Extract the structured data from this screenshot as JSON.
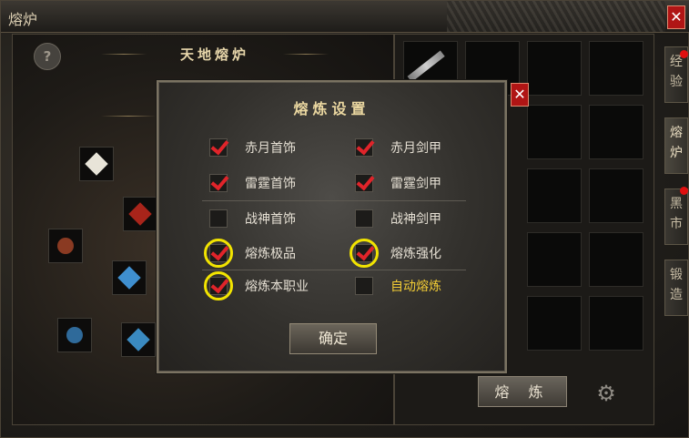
{
  "window": {
    "title": "熔炉",
    "close_label": "✕"
  },
  "furnace": {
    "title": "天地熔炉",
    "help_label": "?"
  },
  "side_tabs": [
    {
      "label": "经验"
    },
    {
      "label": "熔炉"
    },
    {
      "label": "黑市"
    },
    {
      "label": "锻造"
    }
  ],
  "smelt_button": "熔 炼",
  "dialog": {
    "title": "熔炼设置",
    "close_label": "✕",
    "ok_label": "确定",
    "options": [
      {
        "label": "赤月首饰",
        "checked": true,
        "color": "normal"
      },
      {
        "label": "赤月剑甲",
        "checked": true,
        "color": "normal"
      },
      {
        "label": "雷霆首饰",
        "checked": true,
        "color": "normal"
      },
      {
        "label": "雷霆剑甲",
        "checked": true,
        "color": "normal"
      },
      {
        "label": "战神首饰",
        "checked": false,
        "color": "normal"
      },
      {
        "label": "战神剑甲",
        "checked": false,
        "color": "normal"
      },
      {
        "label": "熔炼极品",
        "checked": true,
        "color": "normal"
      },
      {
        "label": "熔炼强化",
        "checked": true,
        "color": "normal"
      },
      {
        "label": "熔炼本职业",
        "checked": true,
        "color": "normal"
      },
      {
        "label": "自动熔炼",
        "checked": false,
        "color": "gold"
      }
    ]
  },
  "colors": {
    "check_red": "#e0242a",
    "highlight_ring": "#f2e400",
    "gold_text": "#f2cc35"
  }
}
